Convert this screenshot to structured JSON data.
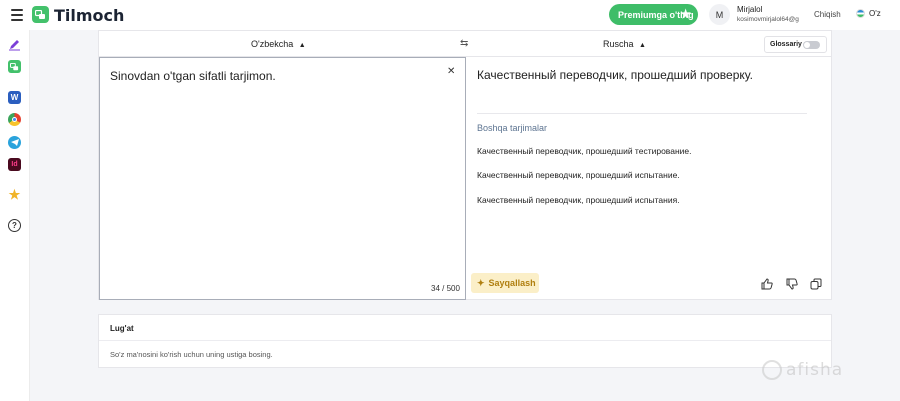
{
  "app": {
    "title": "Tilmoch"
  },
  "header": {
    "premium_label": "Premiumga o'ting",
    "avatar_initial": "M",
    "user_name": "Mirjalol",
    "user_email": "kosimovmirjalol64@g",
    "logout_label": "Chiqish",
    "ui_language": "O'z"
  },
  "sidebar": {
    "items": [
      {
        "icon": "pen-icon",
        "color": "#7b3fd8"
      },
      {
        "icon": "tilmoch-icon",
        "color": "#43c16b"
      },
      {
        "icon": "word-icon",
        "color": "#2b5ebf"
      },
      {
        "icon": "chrome-icon",
        "color": "#e5412f"
      },
      {
        "icon": "telegram-icon",
        "color": "#2aa3dc"
      },
      {
        "icon": "indesign-icon",
        "color": "#b0164a"
      },
      {
        "icon": "star-icon",
        "color": "#f0b429"
      },
      {
        "icon": "help-icon",
        "color": "#333333"
      }
    ]
  },
  "translator": {
    "source_language": "O'zbekcha",
    "target_language": "Ruscha",
    "glossary_label": "Glossariy",
    "glossary_enabled": false,
    "source_text": "Sinovdan o'tgan sifatli tarjimon.",
    "char_count": "34 / 500",
    "target_text": "Качественный переводчик, прошедший проверку.",
    "other_heading": "Boshqa tarjimalar",
    "alternatives": [
      "Качественный переводчик, прошедший тестирование.",
      "Качественный переводчик, прошедший испытание.",
      "Качественный переводчик, прошедший испытания."
    ],
    "polish_label": "Sayqallash"
  },
  "dictionary": {
    "title": "Lug'at",
    "hint": "So'z ma'nosini ko'rish uchun uning ustiga bosing."
  },
  "colors": {
    "accent_green": "#3ebd68",
    "polish_bg": "#fbefc8",
    "polish_text": "#b07f10"
  }
}
